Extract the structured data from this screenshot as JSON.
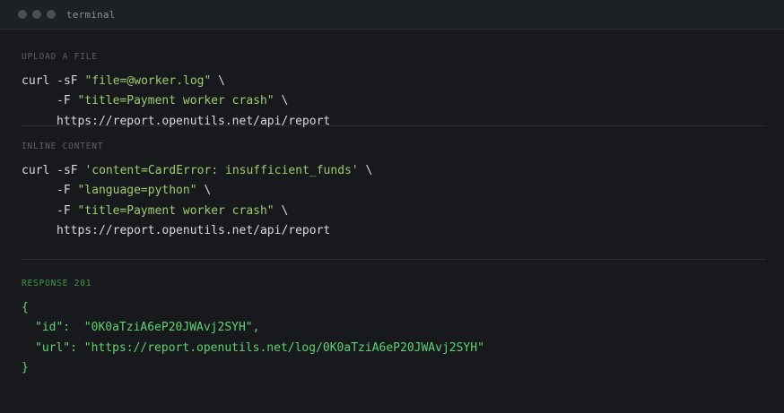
{
  "window": {
    "title": "terminal"
  },
  "upload": {
    "label": "UPLOAD A FILE",
    "line1_cmd": "curl -sF ",
    "line1_str": "\"file=@worker.log\"",
    "line1_tail": " \\",
    "line2_flag": "-F ",
    "line2_str": "\"title=Payment worker crash\"",
    "line2_tail": " \\",
    "line3_url": "https://report.openutils.net/api/report"
  },
  "inline": {
    "label": "INLINE CONTENT",
    "line1_cmd": "curl -sF ",
    "line1_str": "'content=CardError: insufficient_funds'",
    "line1_tail": " \\",
    "line2_flag": "-F ",
    "line2_str": "\"language=python\"",
    "line2_tail": " \\",
    "line3_flag": "-F ",
    "line3_str": "\"title=Payment worker crash\"",
    "line3_tail": " \\",
    "line4_url": "https://report.openutils.net/api/report"
  },
  "response": {
    "label": "RESPONSE 201",
    "open": "{",
    "id_key": "\"id\":",
    "id_value": "  \"0K0aTziA6eP20JWAvj2SYH\",",
    "url_key": "\"url\":",
    "url_value": " \"https://report.openutils.net/log/0K0aTziA6eP20JWAvj2SYH\"",
    "close": "}"
  },
  "colors": {
    "background": "#17191d",
    "string": "#9ccc6e",
    "json": "#5fd36f",
    "label_status": "#3f9a4a"
  }
}
